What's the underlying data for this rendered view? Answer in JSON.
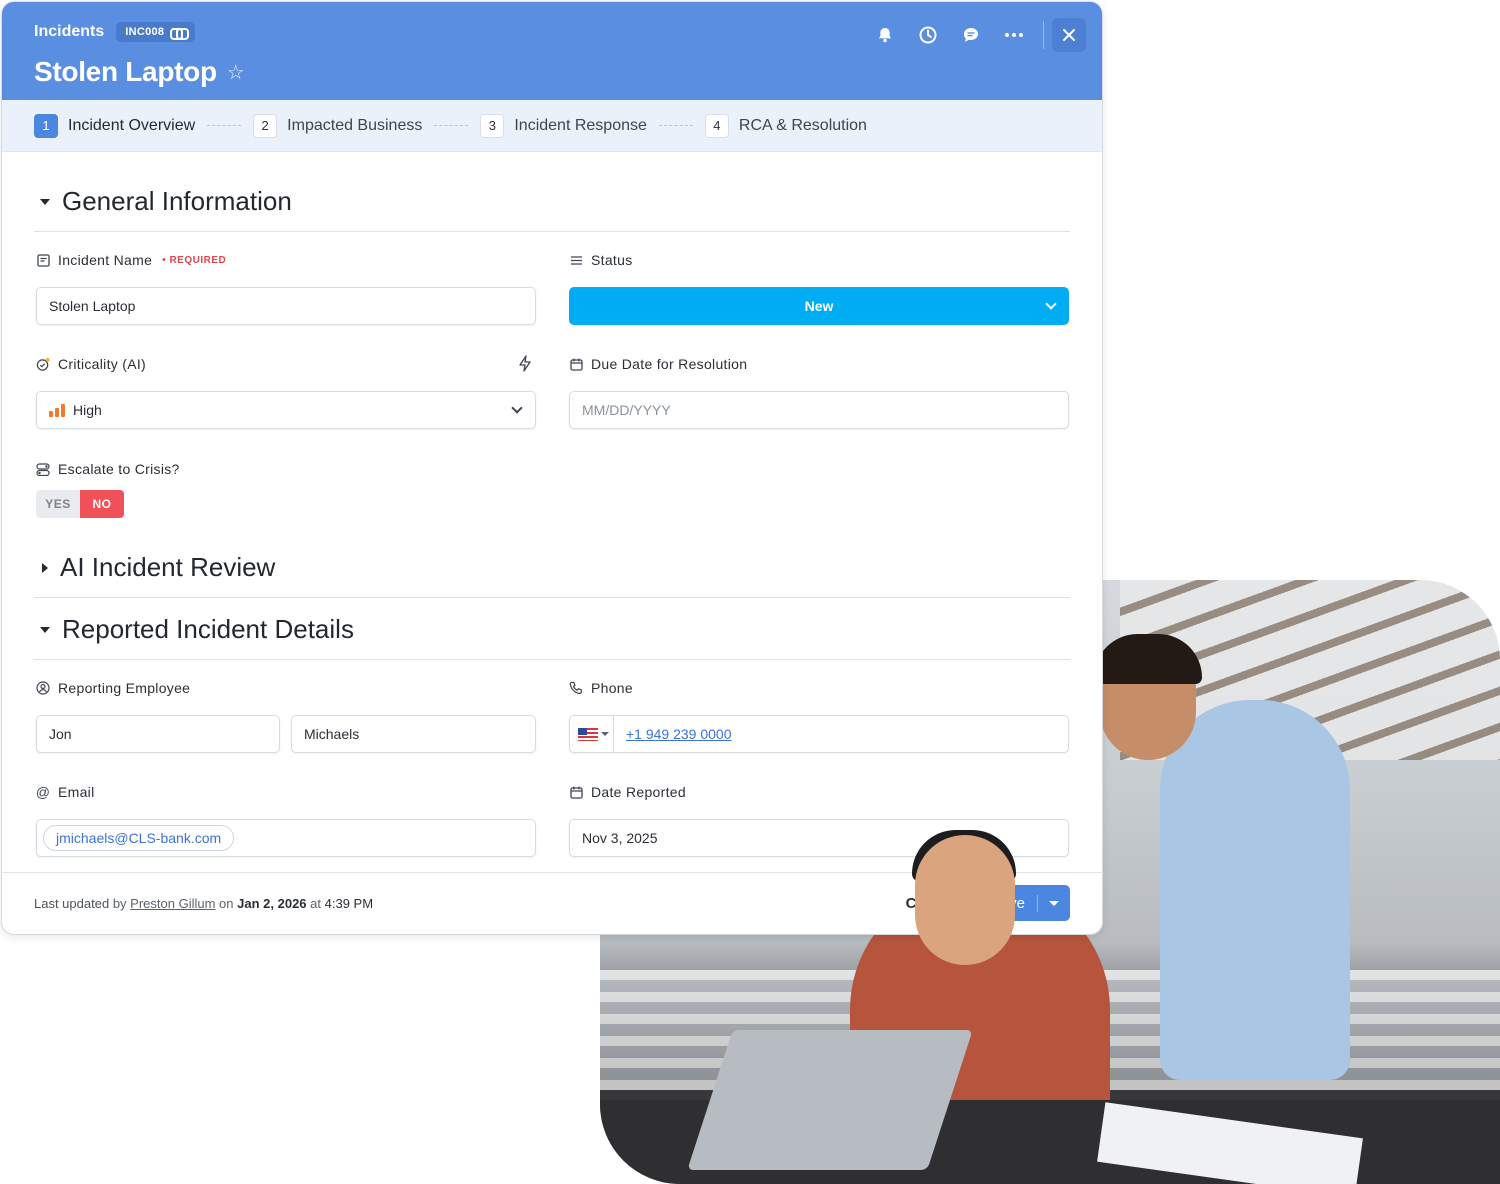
{
  "header": {
    "breadcrumb": "Incidents",
    "record_id": "INC008",
    "title": "Stolen Laptop",
    "icons": [
      "bell-icon",
      "clock-icon",
      "comment-icon",
      "more-icon",
      "close-icon"
    ]
  },
  "steps": [
    {
      "num": "1",
      "label": "Incident Overview",
      "active": true
    },
    {
      "num": "2",
      "label": "Impacted Business"
    },
    {
      "num": "3",
      "label": "Incident Response"
    },
    {
      "num": "4",
      "label": "RCA & Resolution"
    }
  ],
  "sections": {
    "general": "General Information",
    "ai_review": "AI Incident Review",
    "reported": "Reported Incident Details"
  },
  "fields": {
    "incident_name": {
      "label": "Incident Name",
      "required": "• REQUIRED",
      "value": "Stolen Laptop"
    },
    "status": {
      "label": "Status",
      "value": "New"
    },
    "criticality": {
      "label": "Criticality (AI)",
      "value": "High"
    },
    "due_date": {
      "label": "Due Date for Resolution",
      "placeholder": "MM/DD/YYYY"
    },
    "escalate": {
      "label": "Escalate to Crisis?",
      "yes": "YES",
      "no": "NO",
      "selected": "NO"
    },
    "reporting_employee": {
      "label": "Reporting Employee",
      "first": "Jon",
      "last": "Michaels"
    },
    "phone": {
      "label": "Phone",
      "value": "+1 949 239 0000",
      "country": "US"
    },
    "email": {
      "label": "Email",
      "value": "jmichaels@CLS-bank.com"
    },
    "date_reported": {
      "label": "Date Reported",
      "value": "Nov 3, 2025"
    }
  },
  "footer": {
    "last_updated": "Last updated",
    "by": "by",
    "user": "Preston Gillum",
    "on": "on",
    "date": "Jan 2, 2026",
    "at": "at",
    "time": "4:39 PM",
    "cancel": "Cancel",
    "save": "Save"
  },
  "colors": {
    "header": "#5a8ee0",
    "status": "#00acf2",
    "toggle_no": "#f0505a",
    "accent": "#4b87e1"
  }
}
